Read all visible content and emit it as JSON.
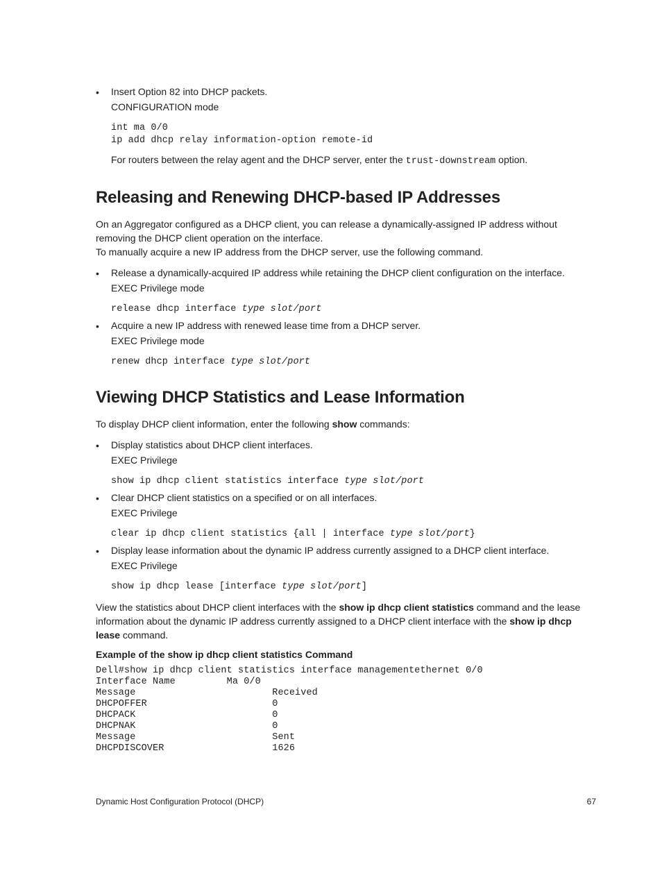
{
  "bullets_intro": [
    {
      "text": "Insert Option 82 into DHCP packets.",
      "mode": "CONFIGURATION mode"
    }
  ],
  "code_intro": "int ma 0/0\nip add dhcp relay information-option remote-id",
  "post_intro_pre": "For routers between the relay agent and the DHCP server, enter the ",
  "post_intro_code": "trust-downstream",
  "post_intro_post": " option.",
  "heading1": "Releasing and Renewing DHCP-based IP Addresses",
  "para1a": "On an Aggregator configured as a DHCP client, you can release a dynamically-assigned IP address without removing the DHCP client operation on the interface.",
  "para1b": "To manually acquire a new IP address from the DHCP server, use the following command.",
  "bullets_h1": [
    {
      "text": "Release a dynamically-acquired IP address while retaining the DHCP client configuration on the interface.",
      "mode": "EXEC Privilege mode",
      "code_plain": "release dhcp interface ",
      "code_italic": "type slot/port"
    },
    {
      "text": "Acquire a new IP address with renewed lease time from a DHCP server.",
      "mode": "EXEC Privilege mode",
      "code_plain": "renew dhcp interface ",
      "code_italic": "type slot/port"
    }
  ],
  "heading2": "Viewing DHCP Statistics and Lease Information",
  "para2_pre": "To display DHCP client information, enter the following ",
  "para2_kw": "show",
  "para2_post": " commands:",
  "bullets_h2": [
    {
      "text": "Display statistics about DHCP client interfaces.",
      "mode": "EXEC Privilege",
      "code_plain": "show ip dhcp client statistics interface ",
      "code_italic": "type slot/port"
    },
    {
      "text": "Clear DHCP client statistics on a specified or on all interfaces.",
      "mode": "EXEC Privilege",
      "code_plain": "clear ip dhcp client statistics {all | interface ",
      "code_italic": "type slot/port",
      "code_tail": "}"
    },
    {
      "text": "Display lease information about the dynamic IP address currently assigned to a DHCP client interface.",
      "mode": "EXEC Privilege",
      "code_plain": "show ip dhcp lease [interface ",
      "code_italic": "type slot/port",
      "code_tail": "]"
    }
  ],
  "para3_pre": "View the statistics about DHCP client interfaces with the ",
  "para3_kw1": "show ip dhcp client statistics",
  "para3_mid": " command and the lease information about the dynamic IP address currently assigned to a DHCP client interface with the ",
  "para3_kw2": "show ip dhcp lease",
  "para3_post": " command.",
  "example_heading": "Example of the show ip dhcp client statistics Command",
  "example_code": "Dell#show ip dhcp client statistics interface managementethernet 0/0\nInterface Name         Ma 0/0\nMessage                        Received\nDHCPOFFER                      0\nDHCPACK                        0\nDHCPNAK                        0\nMessage                        Sent\nDHCPDISCOVER                   1626",
  "footer_left": "Dynamic Host Configuration Protocol (DHCP)",
  "footer_right": "67"
}
